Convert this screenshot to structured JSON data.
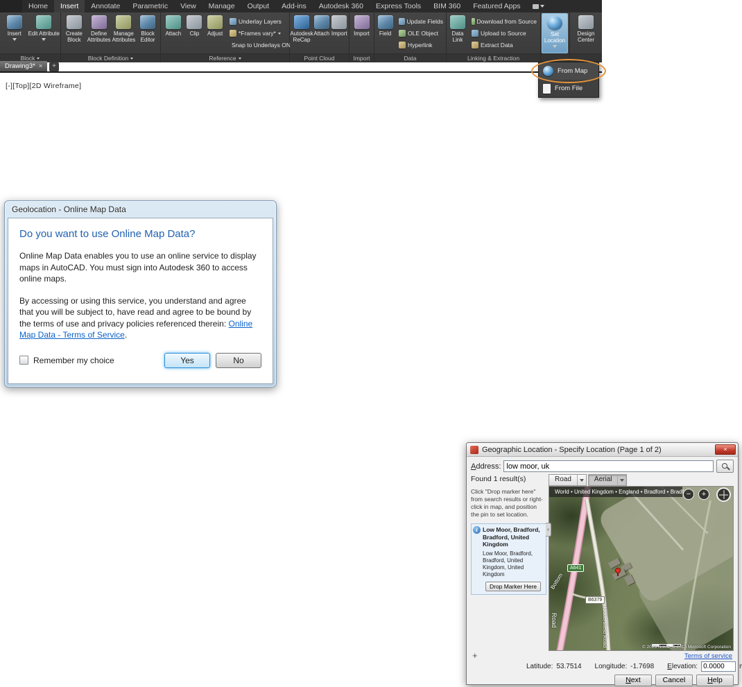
{
  "icons": {
    "zoom_out": "−",
    "zoom_in": "+",
    "window_close": "×",
    "tab_close": "×",
    "new_tab": "+",
    "info": "i",
    "marker_plus": "+",
    "collapse": "‹"
  },
  "app": {
    "ribbon": {
      "tabs": [
        "Home",
        "Insert",
        "Annotate",
        "Parametric",
        "View",
        "Manage",
        "Output",
        "Add-ins",
        "Autodesk 360",
        "Express Tools",
        "BIM 360",
        "Featured Apps"
      ],
      "active_tab": "Insert",
      "block": {
        "label": "Block",
        "insert": "Insert",
        "edit_attribute": "Edit Attribute"
      },
      "block_definition": {
        "label": "Block Definition",
        "create_block": "Create Block",
        "define_attributes": "Define Attributes",
        "manage_attributes": "Manage Attributes",
        "block_editor": "Block Editor"
      },
      "reference": {
        "label": "Reference",
        "attach": "Attach",
        "clip": "Clip",
        "adjust": "Adjust",
        "underlay_layers": "Underlay Layers",
        "frames": "*Frames vary*",
        "snap": "Snap to Underlays ON"
      },
      "point_cloud": {
        "label": "Point Cloud",
        "recap": "Autodesk ReCap",
        "attach": "Attach",
        "import": "Import"
      },
      "import_panel": {
        "label": "Import",
        "import": "Import"
      },
      "data": {
        "label": "Data",
        "field": "Field",
        "update_fields": "Update Fields",
        "ole_object": "OLE Object",
        "hyperlink": "Hyperlink"
      },
      "linking": {
        "label": "Linking & Extraction",
        "data_link": "Data Link",
        "download": "Download from Source",
        "upload": "Upload to Source",
        "extract": "Extract Data"
      },
      "location": {
        "set_location": "Set Location"
      },
      "design_center": "Design Center",
      "location_menu": {
        "from_map": "From Map",
        "from_file": "From File"
      }
    },
    "file_tab": "Drawing3*",
    "viewport_label": "[-][Top][2D Wireframe]"
  },
  "geolocation_dialog": {
    "title": "Geolocation - Online Map Data",
    "heading": "Do you want to use Online Map Data?",
    "paragraph1": "Online Map Data enables you to use an online service to display maps in AutoCAD. You must sign into Autodesk 360 to access online maps.",
    "paragraph2": "By accessing or using this service, you understand and agree that you will be subject to, have read and agree to be bound by the terms of use and privacy policies referenced therein: ",
    "terms_link": "Online Map Data - Terms of Service",
    "terms_suffix": ".",
    "remember_label": "Remember my choice",
    "yes_button": "Yes",
    "no_button": "No"
  },
  "geo_dialog": {
    "title": "Geographic Location - Specify Location (Page 1 of 2)",
    "address_label": "Address:",
    "address_value": "low moor, uk",
    "found_text": "Found 1 result(s)",
    "instruction": "Click \"Drop marker here\" from search results or right-click in map, and position the pin to set location.",
    "result_title": "Low Moor, Bradford, Bradford, United Kingdom",
    "result_detail": "Low Moor, Bradford, Bradford, United Kingdom, United Kingdom",
    "drop_marker_button": "Drop Marker Here",
    "map_tabs": {
      "road": "Road",
      "aerial": "Aerial"
    },
    "breadcrumb": "World • United Kingdom • England • Bradford • Bradford",
    "map_labels": {
      "a641": "A641",
      "b6379": "B6379",
      "bottom": "Bottom",
      "road": "Road",
      "huddersfield": "Huddersfield Road"
    },
    "copyright": "© 2013 Nokia, © 2013 Microsoft Corporation",
    "terms_link": "Terms of service",
    "latitude_label": "Latitude:",
    "latitude_value": "53.7514",
    "longitude_label": "Longitude:",
    "longitude_value": "-1.7698",
    "elevation_label": "Elevation:",
    "elevation_value": "0.0000",
    "units_label": "meters",
    "next_button": "Next",
    "cancel_button": "Cancel",
    "help_button": "Help"
  }
}
